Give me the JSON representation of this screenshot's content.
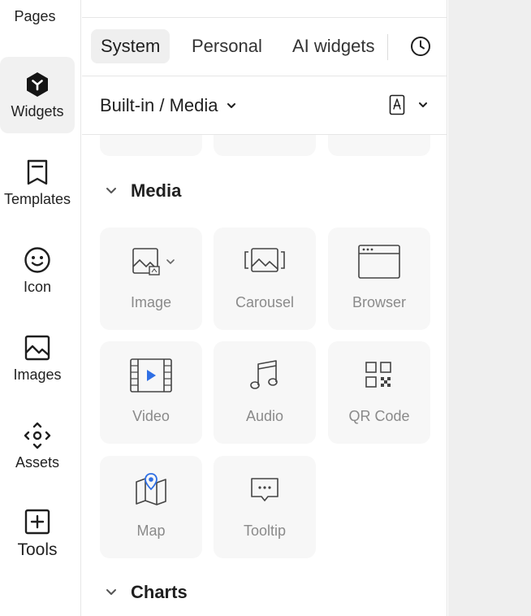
{
  "rail": {
    "items": [
      {
        "label": "Pages",
        "icon": "pages-icon"
      },
      {
        "label": "Widgets",
        "icon": "widgets-icon",
        "active": true
      },
      {
        "label": "Templates",
        "icon": "bookmark-icon"
      },
      {
        "label": "Icon",
        "icon": "smiley-icon"
      },
      {
        "label": "Images",
        "icon": "image-icon"
      },
      {
        "label": "Assets",
        "icon": "assets-icon"
      },
      {
        "label": "Tools",
        "icon": "plus-box-icon"
      }
    ]
  },
  "tabs": {
    "items": [
      "System",
      "Personal",
      "AI widgets"
    ],
    "active": "System"
  },
  "breadcrumb": {
    "label": "Built-in / Media"
  },
  "sections": {
    "media": {
      "title": "Media"
    },
    "charts": {
      "title": "Charts"
    }
  },
  "widgets": [
    {
      "label": "Image",
      "icon": "image-icon"
    },
    {
      "label": "Carousel",
      "icon": "carousel-icon"
    },
    {
      "label": "Browser",
      "icon": "browser-icon"
    },
    {
      "label": "Video",
      "icon": "video-icon"
    },
    {
      "label": "Audio",
      "icon": "audio-icon"
    },
    {
      "label": "QR Code",
      "icon": "qr-code-icon"
    },
    {
      "label": "Map",
      "icon": "map-icon"
    },
    {
      "label": "Tooltip",
      "icon": "tooltip-icon"
    }
  ],
  "colors": {
    "accent": "#2f6fe4",
    "tile_bg": "#f7f7f7",
    "label_gray": "#8a8a8a"
  }
}
